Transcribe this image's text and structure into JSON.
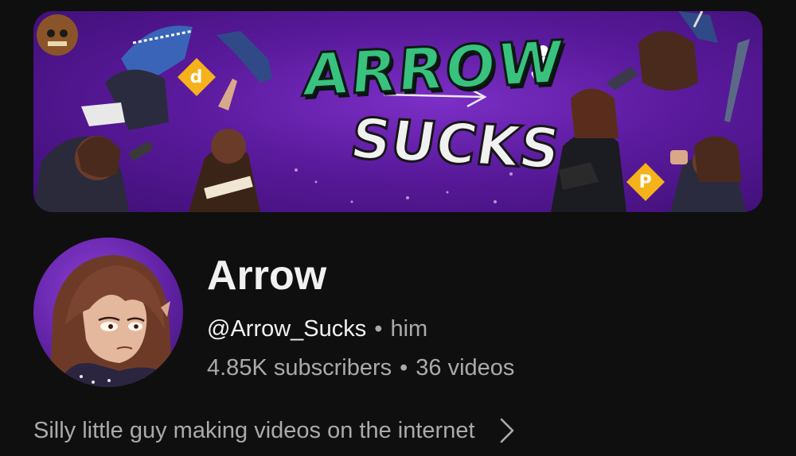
{
  "banner": {
    "title": "ARROW",
    "subtitle": "SUCKS",
    "badge_left": "d",
    "badge_right": "P",
    "colors": {
      "background": "#5a1a9c",
      "title": "#38c27e",
      "subtitle": "#f1f1f1",
      "badge": "#f6b21a"
    }
  },
  "channel": {
    "name": "Arrow",
    "handle": "@Arrow_Sucks",
    "separator": "•",
    "pronouns": "him",
    "subscribers": "4.85K subscribers",
    "videos": "36 videos",
    "description": "Silly little guy making videos on the internet"
  },
  "icons": {
    "description_more": "chevron-right-icon"
  },
  "theme": {
    "background": "#0f0f0f",
    "primary_text": "#f1f1f1",
    "secondary_text": "#aaaaaa",
    "avatar_background": "#6122a6"
  }
}
